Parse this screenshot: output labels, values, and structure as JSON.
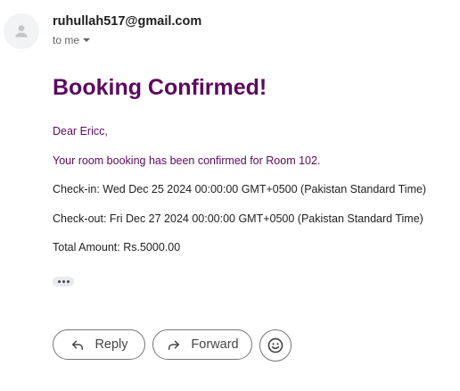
{
  "header": {
    "sender_email": "ruhullah517@gmail.com",
    "recipient_label": "to me"
  },
  "body": {
    "title": "Booking Confirmed!",
    "greeting": "Dear Ericc,",
    "message": "Your room booking has been confirmed for Room 102.",
    "check_in": "Check-in: Wed Dec 25 2024 00:00:00 GMT+0500 (Pakistan Standard Time)",
    "check_out": "Check-out: Fri Dec 27 2024 00:00:00 GMT+0500 (Pakistan Standard Time)",
    "total": "Total Amount: Rs.5000.00"
  },
  "actions": {
    "reply_label": "Reply",
    "forward_label": "Forward"
  },
  "colors": {
    "brand_purple": "#5b0a5e"
  }
}
